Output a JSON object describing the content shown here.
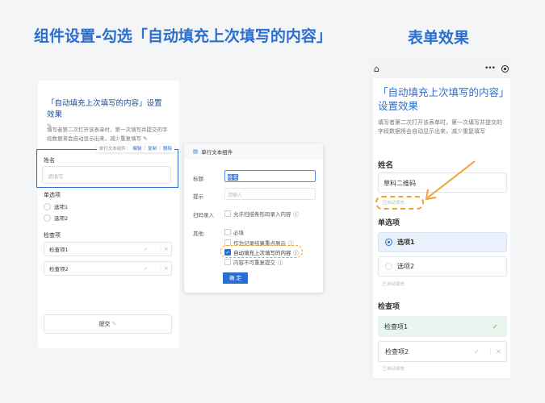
{
  "left_title": "组件设置-勾选「自动填充上次填写的内容」",
  "right_title": "表单效果",
  "editor": {
    "form_title": "「自动填充上次填写的内容」设置效果",
    "form_desc": "填写者第二次打开该表单时，第一次填写并提交的字段数据将会自动显示出来，减少重复填写",
    "toolbar": {
      "label": "单行文本组件：",
      "edit": "编辑",
      "copy": "复制",
      "delete": "删除"
    },
    "name_label": "姓名",
    "name_placeholder": "请填写",
    "radio_label": "单选项",
    "radio_options": [
      "选项1",
      "选项2"
    ],
    "check_label": "检查项",
    "check_items": [
      "检查项1",
      "检查项2"
    ],
    "submit": "提交"
  },
  "settings": {
    "header": "单行文本组件",
    "title_label": "标题",
    "title_value": "姓名",
    "hint_label": "提示",
    "hint_placeholder": "请输入",
    "scan_label": "扫码录入",
    "scan_option": "允许扫描条形码录入内容",
    "other_label": "其他",
    "options": [
      {
        "label": "必填",
        "checked": false
      },
      {
        "label": "作为记录结果重点展示",
        "checked": false
      },
      {
        "label": "自动填充上次填写的内容",
        "checked": true
      },
      {
        "label": "内容不可重复提交",
        "checked": false
      }
    ],
    "confirm": "确 定"
  },
  "preview": {
    "title": "「自动填充上次填写的内容」设置效果",
    "desc": "填写者第二次打开该表单时，第一次填写并提交的字段数据将会自动显示出来，减少重复填写",
    "name_label": "姓名",
    "name_value": "草料二维码",
    "autofill": "已自动填充",
    "radio_label": "单选项",
    "radio_options": [
      "选项1",
      "选项2"
    ],
    "check_label": "检查项",
    "check_items": [
      "检查项1",
      "检查项2"
    ]
  },
  "colors": {
    "accent": "#2a6fd0",
    "highlight": "#f0a030",
    "success": "#4caf50"
  }
}
